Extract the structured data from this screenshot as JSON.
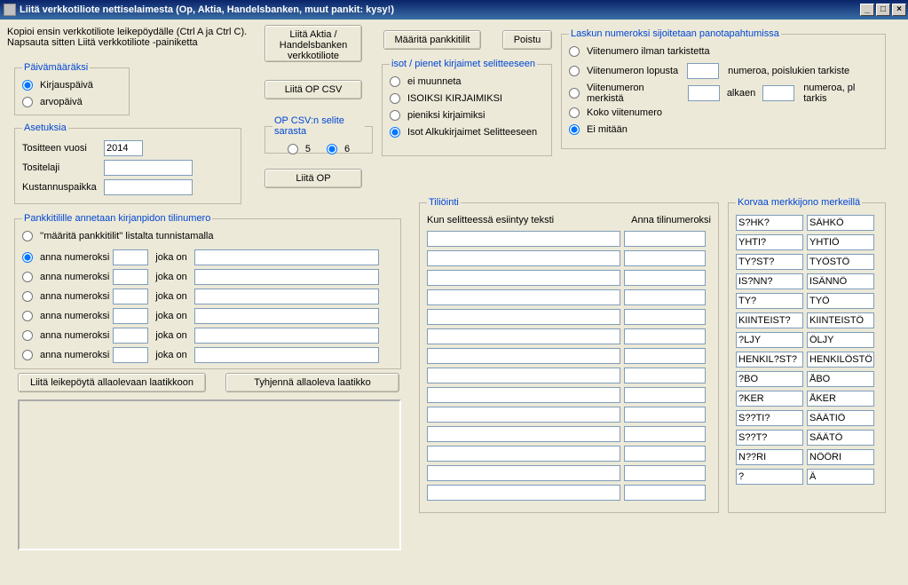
{
  "window": {
    "title": "Liitä verkkotiliote nettiselaimesta (Op, Aktia, Handelsbanken, muut pankit: kysy!)"
  },
  "instructions": {
    "line1": "Kopioi ensin verkkotiliote leikepöydälle (Ctrl A ja Ctrl C).",
    "line2": "Napsauta sitten Liitä verkkotiliote -painiketta"
  },
  "buttons": {
    "liita_aktia": "Liitä Aktia / Handelsbanken verkkotiliote",
    "maarita": "Määritä pankkitilit",
    "poistu": "Poistu",
    "liita_op_csv": "Liitä OP CSV",
    "liita_op": "Liitä OP",
    "liita_leike": "Liitä leikepöytä allaolevaan laatikkoon",
    "tyhjenna": "Tyhjennä allaoleva laatikko"
  },
  "paivamaaraksi": {
    "legend": "Päivämääräksi",
    "kirjaus": "Kirjauspäivä",
    "arvo": "arvopäivä"
  },
  "asetuksia": {
    "legend": "Asetuksia",
    "tositteen_vuosi_label": "Tositteen vuosi",
    "tositteen_vuosi_value": "2014",
    "tositelaji_label": "Tositelaji",
    "tositelaji_value": "",
    "kustannuspaikka_label": "Kustannuspaikka",
    "kustannuspaikka_value": ""
  },
  "opcsv": {
    "legend": "OP CSV:n selite sarasta",
    "opt5": "5",
    "opt6": "6"
  },
  "isotpienet": {
    "legend": "isot / pienet kirjaimet selitteeseen",
    "ei": "ei muunneta",
    "iso": "ISOIKSI KIRJAIMIKSI",
    "pien": "pieniksi kirjaimiksi",
    "alku": "Isot Alkukirjaimet Selitteeseen"
  },
  "laskun": {
    "legend": "Laskun numeroksi sijoitetaan panotapahtumissa",
    "ilman": "Viitenumero ilman tarkistetta",
    "lopusta": "Viitenumeron lopusta",
    "lopusta_suffix": "numeroa, poislukien tarkiste",
    "merkista": "Viitenumeron merkistä",
    "alkaen": "alkaen",
    "merkista_suffix": "numeroa, pl tarkis",
    "koko": "Koko viitenumero",
    "eimitaan": "Ei mitään"
  },
  "pankkitilille": {
    "legend": "Pankkitilille annetaan kirjanpidon tilinumero",
    "listalta": "''määritä pankkitilit'' listalta tunnistamalla",
    "anna": "anna numeroksi",
    "joka_on": "joka on"
  },
  "tiliointi": {
    "legend": "Tiliöinti",
    "col1": "Kun selitteessä esiintyy teksti",
    "col2": "Anna tilinumeroksi"
  },
  "korvaa": {
    "legend": "Korvaa merkkijono  merkeillä",
    "rows": [
      {
        "a": "S?HK?",
        "b": "SÄHKÖ"
      },
      {
        "a": "YHTI?",
        "b": "YHTIÖ"
      },
      {
        "a": "TY?ST?",
        "b": "TYÖSTÖ"
      },
      {
        "a": "IS?NN?",
        "b": "ISÄNNÖ"
      },
      {
        "a": "TY?",
        "b": "TYÖ"
      },
      {
        "a": "KIINTEIST?",
        "b": "KIINTEISTÖ"
      },
      {
        "a": "?LJY",
        "b": "ÖLJY"
      },
      {
        "a": "HENKIL?ST?",
        "b": "HENKILÖSTÖ"
      },
      {
        "a": "?BO",
        "b": "ÅBO"
      },
      {
        "a": "?KER",
        "b": "ÅKER"
      },
      {
        "a": "S??TI?",
        "b": "SÄÄTIÖ"
      },
      {
        "a": "S??T?",
        "b": "SÄÄTÖ"
      },
      {
        "a": "N??RI",
        "b": "NÖÖRI"
      },
      {
        "a": "?",
        "b": "Ä"
      }
    ]
  }
}
